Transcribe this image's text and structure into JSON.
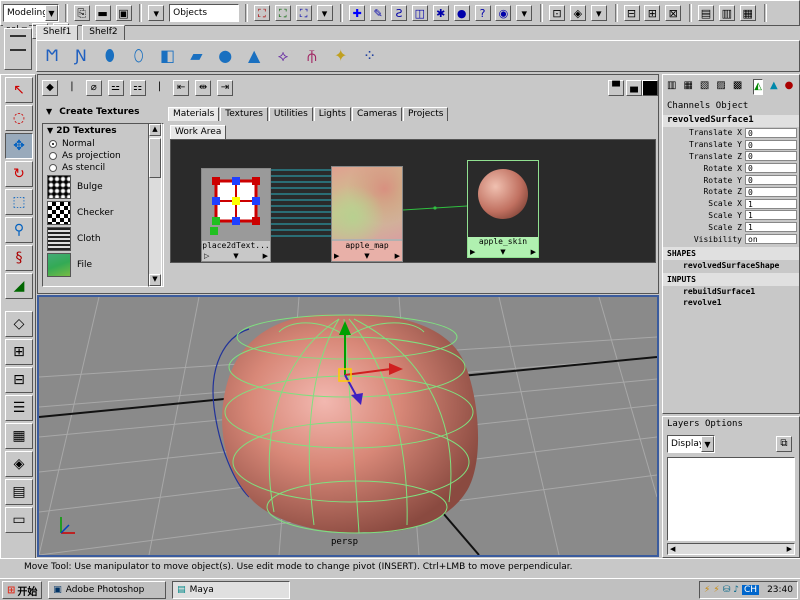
{
  "status_line": {
    "menu_set": "Modeling",
    "selection_field": "Objects",
    "sel_label": "sel"
  },
  "shelf": {
    "tabs": [
      "Shelf1",
      "Shelf2"
    ]
  },
  "hypershade": {
    "create_title": "Create Textures",
    "textures_header": "2D Textures",
    "placement_options": [
      "Normal",
      "As projection",
      "As stencil"
    ],
    "selected_option": "Normal",
    "texture_items": [
      "Bulge",
      "Checker",
      "Cloth",
      "File"
    ],
    "tabs": [
      "Materials",
      "Textures",
      "Utilities",
      "Lights",
      "Cameras",
      "Projects"
    ],
    "active_tab": "Materials",
    "work_area_tab": "Work Area",
    "nodes": {
      "place2d": "place2dText...",
      "apple_map": "apple_map",
      "apple_skin": "apple_skin"
    }
  },
  "viewport": {
    "camera_label": "persp"
  },
  "channel_box": {
    "menu": [
      "Channels",
      "Object"
    ],
    "object_name": "revolvedSurface1",
    "attributes": [
      {
        "name": "Translate X",
        "value": "0"
      },
      {
        "name": "Translate Y",
        "value": "0"
      },
      {
        "name": "Translate Z",
        "value": "0"
      },
      {
        "name": "Rotate X",
        "value": "0"
      },
      {
        "name": "Rotate Y",
        "value": "0"
      },
      {
        "name": "Rotate Z",
        "value": "0"
      },
      {
        "name": "Scale X",
        "value": "1"
      },
      {
        "name": "Scale Y",
        "value": "1"
      },
      {
        "name": "Scale Z",
        "value": "1"
      },
      {
        "name": "Visibility",
        "value": "on"
      }
    ],
    "shapes_header": "SHAPES",
    "shape_name": "revolvedSurfaceShape",
    "inputs_header": "INPUTS",
    "inputs": [
      "rebuildSurface1",
      "revolve1"
    ]
  },
  "layers": {
    "menu": [
      "Layers",
      "Options"
    ],
    "display_label": "Display"
  },
  "help_line": "Move Tool: Use manipulator to move object(s). Use edit mode to change pivot (INSERT). Ctrl+LMB to move perpendicular.",
  "taskbar": {
    "start_label": "开始",
    "tasks": [
      "Adobe Photoshop",
      "Maya"
    ],
    "clock": "23:40",
    "ime": "CH"
  },
  "colors": {
    "viewport_bg": "#8a8a8a",
    "viewport_border": "#3b5c9e",
    "workarea_bg": "#2a2a2a",
    "apple_green_wire": "#7fe07f"
  }
}
